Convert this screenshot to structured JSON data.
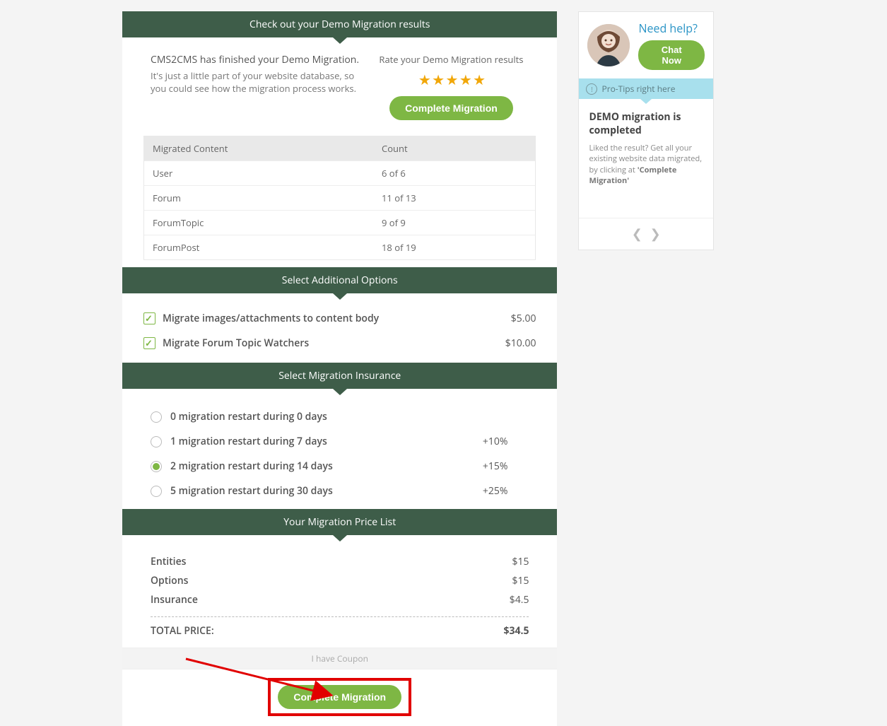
{
  "headers": {
    "results": "Check out your Demo Migration results",
    "options": "Select Additional Options",
    "insurance": "Select Migration Insurance",
    "pricelist": "Your Migration Price List"
  },
  "demo": {
    "lead": "CMS2CMS has finished your Demo Migration.",
    "sub": "It's just a little part of your website database, so you could see how the migration process works.",
    "rateLabel": "Rate your Demo Migration results",
    "cta": "Complete Migration"
  },
  "table": {
    "col1": "Migrated Content",
    "col2": "Count",
    "rows": [
      {
        "name": "User",
        "count": "6 of 6"
      },
      {
        "name": "Forum",
        "count": "11 of 13"
      },
      {
        "name": "ForumTopic",
        "count": "9 of 9"
      },
      {
        "name": "ForumPost",
        "count": "18 of 19"
      }
    ]
  },
  "options": [
    {
      "label": "Migrate images/attachments to content body",
      "price": "$5.00"
    },
    {
      "label": "Migrate Forum Topic Watchers",
      "price": "$10.00"
    }
  ],
  "insurance": [
    {
      "label": "0 migration restart during 0 days",
      "pct": "",
      "selected": false
    },
    {
      "label": "1 migration restart during 7 days",
      "pct": "+10%",
      "selected": false
    },
    {
      "label": "2 migration restart during 14 days",
      "pct": "+15%",
      "selected": true
    },
    {
      "label": "5 migration restart during 30 days",
      "pct": "+25%",
      "selected": false
    }
  ],
  "price": {
    "entitiesLabel": "Entities",
    "entities": "$15",
    "optionsLabel": "Options",
    "options": "$15",
    "insuranceLabel": "Insurance",
    "insurance": "$4.5",
    "totalLabel": "TOTAL PRICE:",
    "total": "$34.5",
    "coupon": "I have Coupon",
    "cta": "Complete Migration"
  },
  "side": {
    "help": "Need help?",
    "chat": "Chat Now",
    "tipsBar": "Pro-Tips right here",
    "tipTitle": "DEMO migration is completed",
    "tipText1": "Liked the result? Get all your existing website data migrated, by clicking at ",
    "tipText2": "'Complete Migration'"
  }
}
